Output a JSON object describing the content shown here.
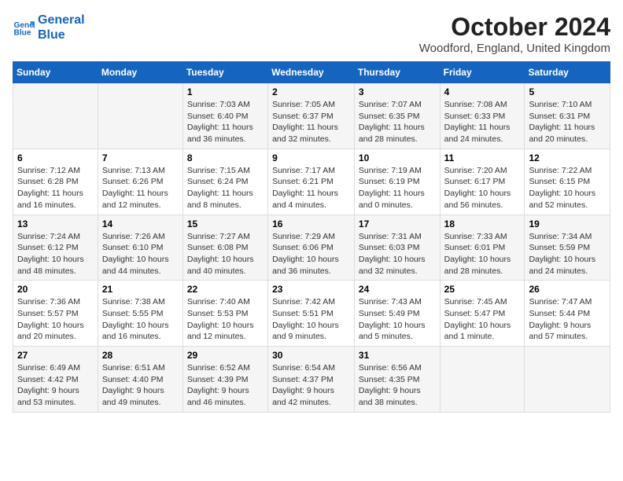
{
  "header": {
    "logo_line1": "General",
    "logo_line2": "Blue",
    "month": "October 2024",
    "location": "Woodford, England, United Kingdom"
  },
  "days_of_week": [
    "Sunday",
    "Monday",
    "Tuesday",
    "Wednesday",
    "Thursday",
    "Friday",
    "Saturday"
  ],
  "weeks": [
    [
      {
        "day": "",
        "info": ""
      },
      {
        "day": "",
        "info": ""
      },
      {
        "day": "1",
        "info": "Sunrise: 7:03 AM\nSunset: 6:40 PM\nDaylight: 11 hours and 36 minutes."
      },
      {
        "day": "2",
        "info": "Sunrise: 7:05 AM\nSunset: 6:37 PM\nDaylight: 11 hours and 32 minutes."
      },
      {
        "day": "3",
        "info": "Sunrise: 7:07 AM\nSunset: 6:35 PM\nDaylight: 11 hours and 28 minutes."
      },
      {
        "day": "4",
        "info": "Sunrise: 7:08 AM\nSunset: 6:33 PM\nDaylight: 11 hours and 24 minutes."
      },
      {
        "day": "5",
        "info": "Sunrise: 7:10 AM\nSunset: 6:31 PM\nDaylight: 11 hours and 20 minutes."
      }
    ],
    [
      {
        "day": "6",
        "info": "Sunrise: 7:12 AM\nSunset: 6:28 PM\nDaylight: 11 hours and 16 minutes."
      },
      {
        "day": "7",
        "info": "Sunrise: 7:13 AM\nSunset: 6:26 PM\nDaylight: 11 hours and 12 minutes."
      },
      {
        "day": "8",
        "info": "Sunrise: 7:15 AM\nSunset: 6:24 PM\nDaylight: 11 hours and 8 minutes."
      },
      {
        "day": "9",
        "info": "Sunrise: 7:17 AM\nSunset: 6:21 PM\nDaylight: 11 hours and 4 minutes."
      },
      {
        "day": "10",
        "info": "Sunrise: 7:19 AM\nSunset: 6:19 PM\nDaylight: 11 hours and 0 minutes."
      },
      {
        "day": "11",
        "info": "Sunrise: 7:20 AM\nSunset: 6:17 PM\nDaylight: 10 hours and 56 minutes."
      },
      {
        "day": "12",
        "info": "Sunrise: 7:22 AM\nSunset: 6:15 PM\nDaylight: 10 hours and 52 minutes."
      }
    ],
    [
      {
        "day": "13",
        "info": "Sunrise: 7:24 AM\nSunset: 6:12 PM\nDaylight: 10 hours and 48 minutes."
      },
      {
        "day": "14",
        "info": "Sunrise: 7:26 AM\nSunset: 6:10 PM\nDaylight: 10 hours and 44 minutes."
      },
      {
        "day": "15",
        "info": "Sunrise: 7:27 AM\nSunset: 6:08 PM\nDaylight: 10 hours and 40 minutes."
      },
      {
        "day": "16",
        "info": "Sunrise: 7:29 AM\nSunset: 6:06 PM\nDaylight: 10 hours and 36 minutes."
      },
      {
        "day": "17",
        "info": "Sunrise: 7:31 AM\nSunset: 6:03 PM\nDaylight: 10 hours and 32 minutes."
      },
      {
        "day": "18",
        "info": "Sunrise: 7:33 AM\nSunset: 6:01 PM\nDaylight: 10 hours and 28 minutes."
      },
      {
        "day": "19",
        "info": "Sunrise: 7:34 AM\nSunset: 5:59 PM\nDaylight: 10 hours and 24 minutes."
      }
    ],
    [
      {
        "day": "20",
        "info": "Sunrise: 7:36 AM\nSunset: 5:57 PM\nDaylight: 10 hours and 20 minutes."
      },
      {
        "day": "21",
        "info": "Sunrise: 7:38 AM\nSunset: 5:55 PM\nDaylight: 10 hours and 16 minutes."
      },
      {
        "day": "22",
        "info": "Sunrise: 7:40 AM\nSunset: 5:53 PM\nDaylight: 10 hours and 12 minutes."
      },
      {
        "day": "23",
        "info": "Sunrise: 7:42 AM\nSunset: 5:51 PM\nDaylight: 10 hours and 9 minutes."
      },
      {
        "day": "24",
        "info": "Sunrise: 7:43 AM\nSunset: 5:49 PM\nDaylight: 10 hours and 5 minutes."
      },
      {
        "day": "25",
        "info": "Sunrise: 7:45 AM\nSunset: 5:47 PM\nDaylight: 10 hours and 1 minute."
      },
      {
        "day": "26",
        "info": "Sunrise: 7:47 AM\nSunset: 5:44 PM\nDaylight: 9 hours and 57 minutes."
      }
    ],
    [
      {
        "day": "27",
        "info": "Sunrise: 6:49 AM\nSunset: 4:42 PM\nDaylight: 9 hours and 53 minutes."
      },
      {
        "day": "28",
        "info": "Sunrise: 6:51 AM\nSunset: 4:40 PM\nDaylight: 9 hours and 49 minutes."
      },
      {
        "day": "29",
        "info": "Sunrise: 6:52 AM\nSunset: 4:39 PM\nDaylight: 9 hours and 46 minutes."
      },
      {
        "day": "30",
        "info": "Sunrise: 6:54 AM\nSunset: 4:37 PM\nDaylight: 9 hours and 42 minutes."
      },
      {
        "day": "31",
        "info": "Sunrise: 6:56 AM\nSunset: 4:35 PM\nDaylight: 9 hours and 38 minutes."
      },
      {
        "day": "",
        "info": ""
      },
      {
        "day": "",
        "info": ""
      }
    ]
  ]
}
